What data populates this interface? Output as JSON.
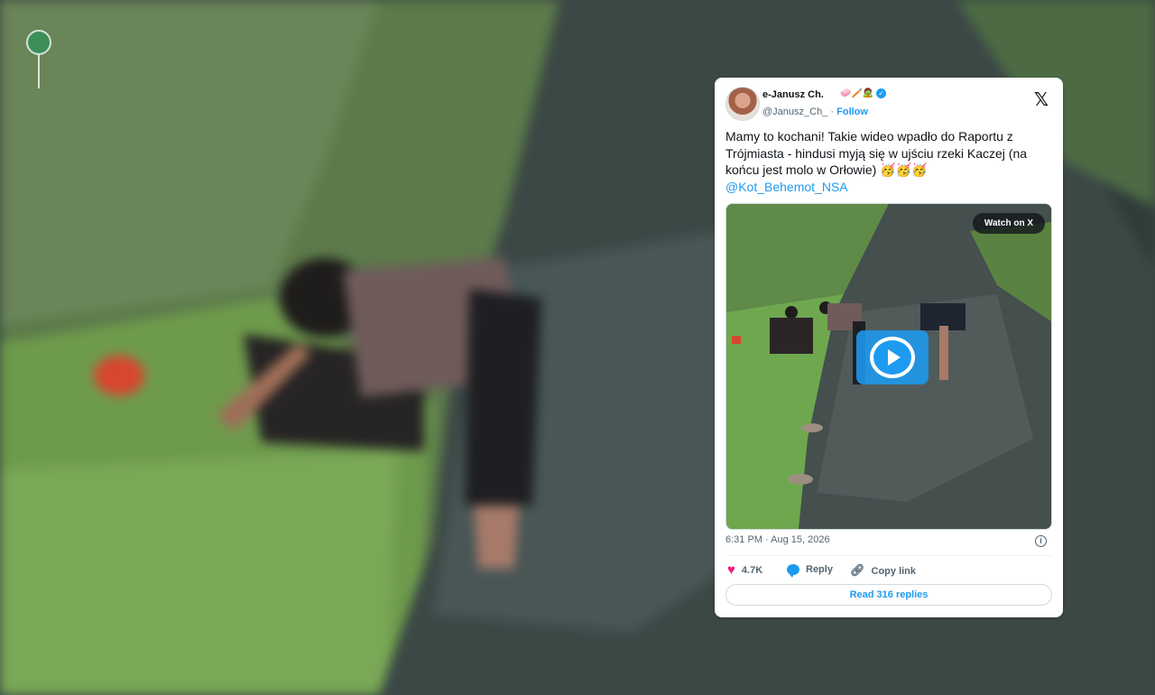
{
  "tweet": {
    "author_name": "e-Janusz Ch.",
    "author_emojis": "🧼🪥🧟",
    "handle": "@Janusz_Ch_",
    "separator": "·",
    "follow_label": "Follow",
    "text": "Mamy to kochani! Takie wideo wpadło do Raportu z Trójmiasta - hindusi myją się w ujściu rzeki Kaczej (na końcu jest molo w Orłowie) 🥳🥳🥳",
    "mention": "@Kot_Behemot_NSA",
    "watch_label": "Watch on X",
    "time": "6:31 PM · Aug 15, 2026",
    "likes": "4.7K",
    "reply_label": "Reply",
    "copy_label": "Copy link",
    "read_replies": "Read 316 replies",
    "x_logo": "𝕏"
  },
  "icons": [
    "map-pin-icon",
    "x-logo-icon",
    "verified-icon",
    "heart-icon",
    "reply-icon",
    "link-icon",
    "info-icon",
    "play-icon"
  ],
  "colors": {
    "accent": "#1d9bf0",
    "like": "#f91880",
    "text": "#0f1419",
    "muted": "#536471"
  }
}
